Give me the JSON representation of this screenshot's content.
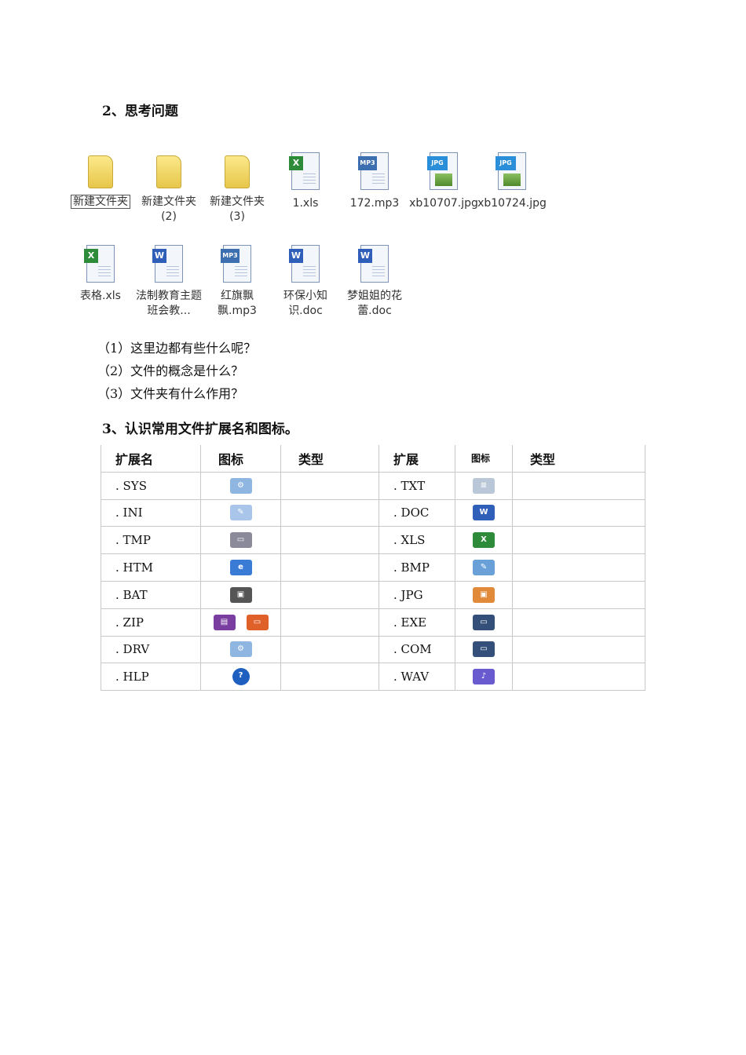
{
  "section2": {
    "heading": "2、思考问题"
  },
  "files": [
    {
      "label": "新建文件夹",
      "icon": "folder-icon",
      "selected": true
    },
    {
      "label": "新建文件夹 (2)",
      "icon": "folder-icon"
    },
    {
      "label": "新建文件夹 (3)",
      "icon": "folder-icon"
    },
    {
      "label": "1.xls",
      "icon": "excel-file-icon"
    },
    {
      "label": "172.mp3",
      "icon": "mp3-file-icon"
    },
    {
      "label": "xb10707.jpg",
      "icon": "jpg-file-icon"
    },
    {
      "label": "xb10724.jpg",
      "icon": "jpg-file-icon"
    },
    {
      "label": "表格.xls",
      "icon": "excel-file-icon"
    },
    {
      "label": "法制教育主题班会教...",
      "icon": "word-file-icon"
    },
    {
      "label": "红旗飘飘.mp3",
      "icon": "mp3-file-icon"
    },
    {
      "label": "环保小知识.doc",
      "icon": "word-file-icon"
    },
    {
      "label": "梦姐姐的花蕾.doc",
      "icon": "word-file-icon"
    }
  ],
  "questions": [
    "（1）这里边都有些什么呢？",
    "（2）文件的概念是什么？",
    "（3）文件夹有什么作用？"
  ],
  "section3": {
    "heading": "3、认识常用文件扩展名和图标。"
  },
  "table": {
    "headers": [
      "扩展名",
      "图标",
      "类型",
      "扩展",
      "图标",
      "类型"
    ],
    "rows": [
      {
        "left": {
          "ext": ". SYS",
          "icon": "system-file-icon"
        },
        "right": {
          "ext": ". TXT",
          "icon": "text-file-icon"
        }
      },
      {
        "left": {
          "ext": ". INI",
          "icon": "config-file-icon"
        },
        "right": {
          "ext": ". DOC",
          "icon": "word-doc-icon"
        }
      },
      {
        "left": {
          "ext": ". TMP",
          "icon": "temp-file-icon"
        },
        "right": {
          "ext": ". XLS",
          "icon": "excel-doc-icon"
        }
      },
      {
        "left": {
          "ext": ". HTM",
          "icon": "html-file-icon"
        },
        "right": {
          "ext": ". BMP",
          "icon": "bitmap-file-icon"
        }
      },
      {
        "left": {
          "ext": ". BAT",
          "icon": "batch-file-icon"
        },
        "right": {
          "ext": ". JPG",
          "icon": "jpeg-file-icon"
        }
      },
      {
        "left": {
          "ext": ". ZIP",
          "icon": "zip-archive-icon"
        },
        "right": {
          "ext": ". EXE",
          "icon": "executable-window-icon"
        }
      },
      {
        "left": {
          "ext": ". DRV",
          "icon": "driver-file-icon"
        },
        "right": {
          "ext": ". COM",
          "icon": "command-window-icon"
        }
      },
      {
        "left": {
          "ext": ". HLP",
          "icon": "help-file-icon"
        },
        "right": {
          "ext": ". WAV",
          "icon": "wav-audio-icon"
        }
      }
    ]
  },
  "colors": {
    "excel": "#2e8b3a",
    "word": "#2f5fb8",
    "mp3": "#3b6fb0",
    "folder": "#f2d765"
  }
}
